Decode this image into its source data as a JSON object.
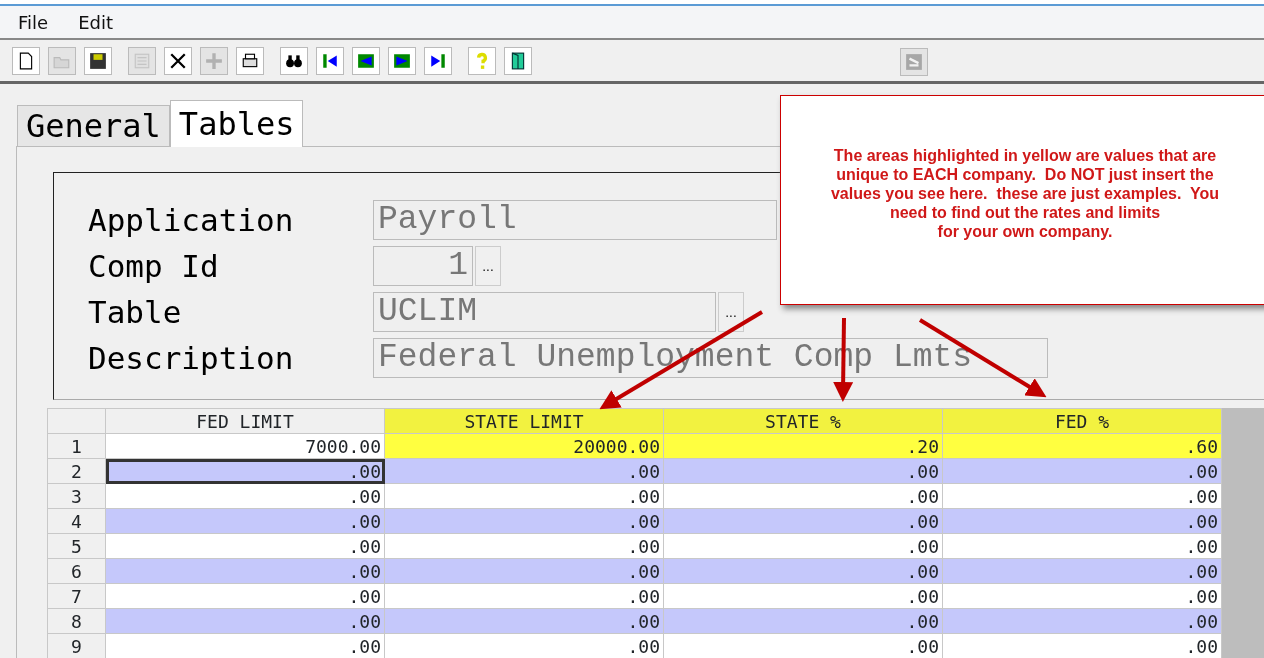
{
  "menu": [
    {
      "label": "File"
    },
    {
      "label": "Edit"
    }
  ],
  "toolbar": [
    {
      "kind": "new",
      "disabled": false
    },
    {
      "kind": "open",
      "disabled": true
    },
    {
      "kind": "save",
      "disabled": false
    },
    {
      "kind": "list",
      "disabled": true
    },
    {
      "kind": "delete",
      "disabled": false
    },
    {
      "kind": "add",
      "disabled": true
    },
    {
      "kind": "print",
      "disabled": false
    },
    {
      "kind": "find",
      "disabled": false
    },
    {
      "kind": "first",
      "disabled": false
    },
    {
      "kind": "previous",
      "disabled": false
    },
    {
      "kind": "next",
      "disabled": false
    },
    {
      "kind": "last",
      "disabled": false
    },
    {
      "kind": "help",
      "disabled": false
    },
    {
      "kind": "exit",
      "disabled": false
    }
  ],
  "toolbar_right": [
    {
      "kind": "tool",
      "disabled": true
    }
  ],
  "tabs": [
    {
      "label": "General",
      "selected": false
    },
    {
      "label": "Tables",
      "selected": true
    }
  ],
  "form": [
    {
      "label": "Application",
      "value": "Payroll",
      "kind": "wide",
      "lookup": false
    },
    {
      "label": "Comp Id",
      "value": "1",
      "kind": "number",
      "lookup": true,
      "lookup_label": "..."
    },
    {
      "label": "Table",
      "value": "UCLIM",
      "kind": "medium",
      "lookup": true,
      "lookup_label": "..."
    },
    {
      "label": "Description",
      "value": "Federal Unemployment Comp Lmts",
      "kind": "long",
      "lookup": false
    }
  ],
  "table": {
    "columns": [
      {
        "label": "FED LIMIT",
        "highlighted": false
      },
      {
        "label": "STATE LIMIT",
        "highlighted": true
      },
      {
        "label": "STATE %",
        "highlighted": true
      },
      {
        "label": "FED %",
        "highlighted": true
      }
    ],
    "rows": [
      {
        "number": "1",
        "striped": false,
        "highlighted": true,
        "cells": [
          {
            "text": "7000.00",
            "selected": false
          },
          {
            "text": "20000.00",
            "selected": false
          },
          {
            "text": ".20",
            "selected": false
          },
          {
            "text": ".60",
            "selected": false
          }
        ]
      },
      {
        "number": "2",
        "striped": true,
        "highlighted": false,
        "cells": [
          {
            "text": ".00",
            "selected": true
          },
          {
            "text": ".00",
            "selected": false
          },
          {
            "text": ".00",
            "selected": false
          },
          {
            "text": ".00",
            "selected": false
          }
        ]
      },
      {
        "number": "3",
        "striped": false,
        "highlighted": false,
        "cells": [
          {
            "text": ".00",
            "selected": false
          },
          {
            "text": ".00",
            "selected": false
          },
          {
            "text": ".00",
            "selected": false
          },
          {
            "text": ".00",
            "selected": false
          }
        ]
      },
      {
        "number": "4",
        "striped": true,
        "highlighted": false,
        "cells": [
          {
            "text": ".00",
            "selected": false
          },
          {
            "text": ".00",
            "selected": false
          },
          {
            "text": ".00",
            "selected": false
          },
          {
            "text": ".00",
            "selected": false
          }
        ]
      },
      {
        "number": "5",
        "striped": false,
        "highlighted": false,
        "cells": [
          {
            "text": ".00",
            "selected": false
          },
          {
            "text": ".00",
            "selected": false
          },
          {
            "text": ".00",
            "selected": false
          },
          {
            "text": ".00",
            "selected": false
          }
        ]
      },
      {
        "number": "6",
        "striped": true,
        "highlighted": false,
        "cells": [
          {
            "text": ".00",
            "selected": false
          },
          {
            "text": ".00",
            "selected": false
          },
          {
            "text": ".00",
            "selected": false
          },
          {
            "text": ".00",
            "selected": false
          }
        ]
      },
      {
        "number": "7",
        "striped": false,
        "highlighted": false,
        "cells": [
          {
            "text": ".00",
            "selected": false
          },
          {
            "text": ".00",
            "selected": false
          },
          {
            "text": ".00",
            "selected": false
          },
          {
            "text": ".00",
            "selected": false
          }
        ]
      },
      {
        "number": "8",
        "striped": true,
        "highlighted": false,
        "cells": [
          {
            "text": ".00",
            "selected": false
          },
          {
            "text": ".00",
            "selected": false
          },
          {
            "text": ".00",
            "selected": false
          },
          {
            "text": ".00",
            "selected": false
          }
        ]
      },
      {
        "number": "9",
        "striped": false,
        "highlighted": false,
        "cells": [
          {
            "text": ".00",
            "selected": false
          },
          {
            "text": ".00",
            "selected": false
          },
          {
            "text": ".00",
            "selected": false
          },
          {
            "text": ".00",
            "selected": false
          }
        ]
      }
    ]
  },
  "callout": {
    "lines": [
      "The areas highlighted in yellow are values that are",
      "unique to EACH company.  Do NOT just insert the",
      "values you see here.  these are just examples.  You",
      "need to find out the rates and limits",
      "for your own company."
    ]
  }
}
